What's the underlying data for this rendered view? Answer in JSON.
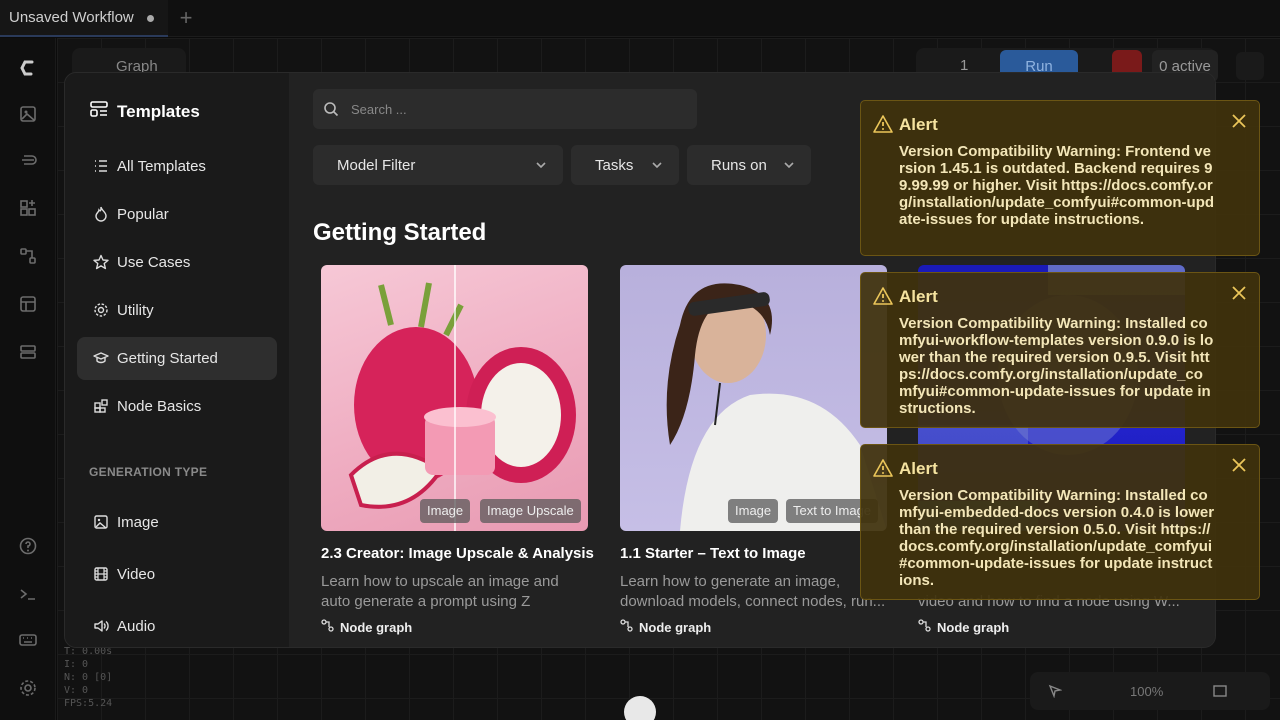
{
  "tabs": {
    "workflow_title": "Unsaved Workflow"
  },
  "toolbar": {
    "graph_label": "Graph",
    "queue_count": "1",
    "run_label": "Run",
    "active_label": "0 active"
  },
  "stats": [
    "T: 0.00s",
    "I: 0",
    "N: 0 [0]",
    "V: 0",
    "FPS:5.24"
  ],
  "bottom_tools": {
    "zoom": "100%"
  },
  "modal": {
    "title": "Templates",
    "nav": [
      {
        "label": "All Templates",
        "icon": "list-icon"
      },
      {
        "label": "Popular",
        "icon": "flame-icon"
      },
      {
        "label": "Use Cases",
        "icon": "star-icon"
      },
      {
        "label": "Utility",
        "icon": "gear-icon"
      },
      {
        "label": "Getting Started",
        "icon": "graduation-cap-icon",
        "active": true
      },
      {
        "label": "Node Basics",
        "icon": "blocks-icon"
      }
    ],
    "generation_type_heading": "GENERATION TYPE",
    "gen_nav": [
      {
        "label": "Image",
        "icon": "image-icon"
      },
      {
        "label": "Video",
        "icon": "film-icon"
      },
      {
        "label": "Audio",
        "icon": "speaker-icon"
      }
    ],
    "search_placeholder": "Search ...",
    "filters": {
      "model": "Model Filter",
      "tasks": "Tasks",
      "runs_on": "Runs on"
    },
    "section_title": "Getting Started",
    "cards": [
      {
        "title": "2.3 Creator: Image Upscale & Analysis",
        "desc": "Learn how to upscale an image and auto generate a prompt using Z Image...",
        "tags": [
          "Image",
          "Image Upscale"
        ],
        "foot": "Node graph"
      },
      {
        "title": "1.1 Starter – Text to Image",
        "desc": "Learn how to generate an image, download models, connect nodes, run...",
        "tags": [
          "Image",
          "Text to Image"
        ],
        "foot": "Node graph"
      },
      {
        "title": "",
        "desc": "video and how to find a node using W...",
        "tags": [],
        "foot": "Node graph"
      }
    ]
  },
  "alerts": [
    {
      "title": "Alert",
      "message": "Version Compatibility Warning: Frontend version 1.45.1 is outdated. Backend requires 99.99.99 or higher. Visit https://docs.comfy.org/installation/update_comfyui#common-update-issues for update instructions."
    },
    {
      "title": "Alert",
      "message": "Version Compatibility Warning: Installed comfyui-workflow-templates version 0.9.0 is lower than the required version 0.9.5. Visit https://docs.comfy.org/installation/update_comfyui#common-update-issues for update instructions."
    },
    {
      "title": "Alert",
      "message": "Version Compatibility Warning: Installed comfyui-embedded-docs version 0.4.0 is lower than the required version 0.5.0. Visit https://docs.comfy.org/installation/update_comfyui#common-update-issues for update instructions."
    }
  ],
  "colors": {
    "accent": "#2a5a9a",
    "alert_bg": "#40320c",
    "alert_border": "#6b5514",
    "modal_bg": "#1e1e1e"
  }
}
